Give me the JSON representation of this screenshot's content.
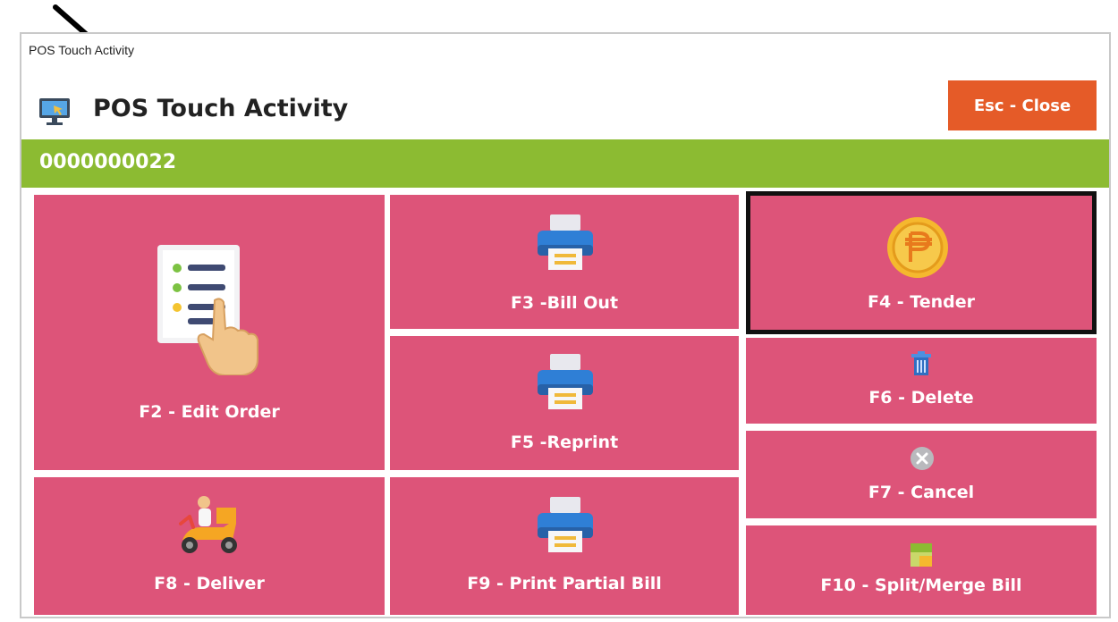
{
  "window": {
    "caption": "POS Touch Activity"
  },
  "header": {
    "title": "POS Touch Activity",
    "close_label": "Esc - Close",
    "icon": "computer-monitor-icon"
  },
  "order_bar": {
    "order_number": "0000000022"
  },
  "tiles": {
    "edit_order": {
      "label": "F2 - Edit Order",
      "icon": "document-hand-icon"
    },
    "bill_out": {
      "label": "F3 -Bill Out",
      "icon": "printer-icon"
    },
    "tender": {
      "label": "F4 - Tender",
      "icon": "peso-coin-icon"
    },
    "reprint": {
      "label": "F5 -Reprint",
      "icon": "printer-icon"
    },
    "delete": {
      "label": "F6 - Delete",
      "icon": "trash-icon"
    },
    "cancel": {
      "label": "F7 - Cancel",
      "icon": "cancel-circle-icon"
    },
    "deliver": {
      "label": "F8 - Deliver",
      "icon": "scooter-delivery-icon"
    },
    "print_partial": {
      "label": "F9 - Print Partial Bill",
      "icon": "printer-icon"
    },
    "split_merge": {
      "label": "F10 - Split/Merge Bill",
      "icon": "split-merge-icon"
    }
  },
  "colors": {
    "tile": "#dd5479",
    "order_bar": "#8cbb32",
    "close_button": "#e55b28"
  }
}
